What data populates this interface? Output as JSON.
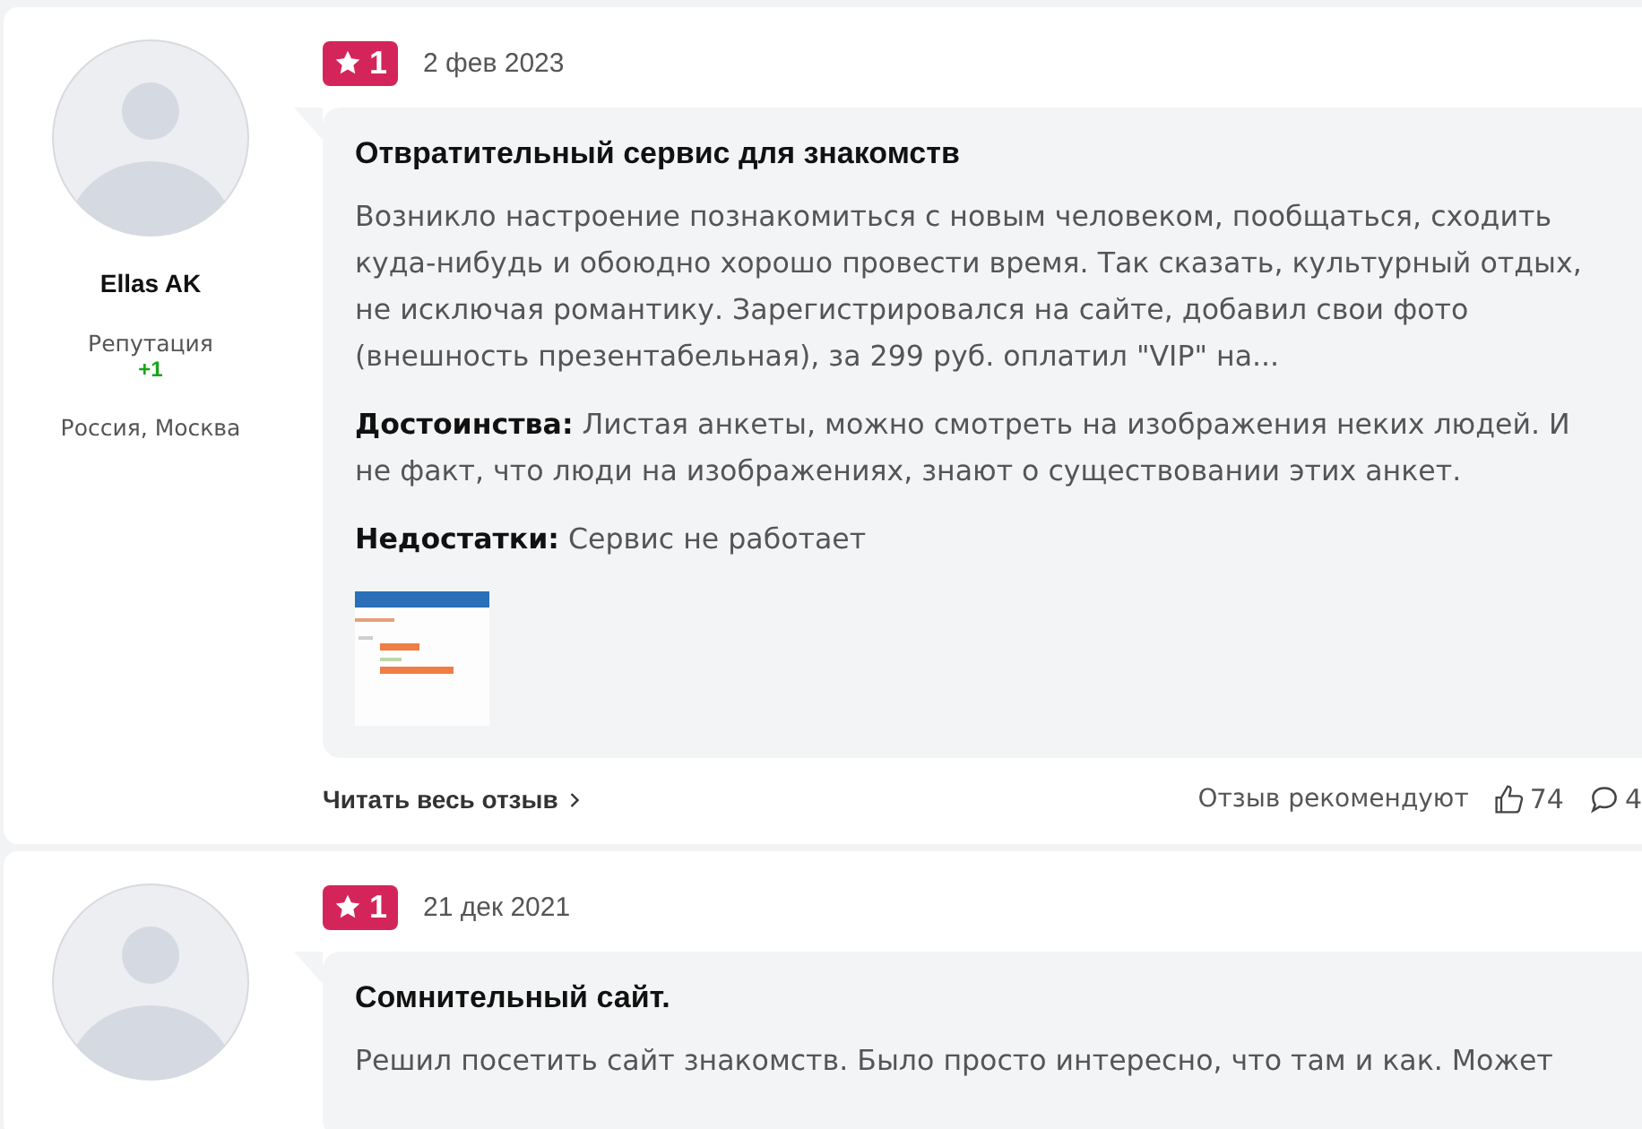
{
  "reviews": [
    {
      "author": {
        "name": "Ellas AK",
        "reputation_label": "Репутация",
        "reputation": "+1",
        "location": "Россия, Москва"
      },
      "rating": "1",
      "date": "2 фев 2023",
      "title": "Отвратительный сервис для знакомств",
      "body": "Возникло настроение познакомиться с новым человеком, пообщаться, сходить куда-нибудь и обоюдно хорошо провести время. Так сказать, культурный отдых, не исключая романтику. Зарегистрировался на сайте, добавил свои фото (внешность презентабельная), за 299 руб. оплатил \"VIP\" на...",
      "pros": "**Достоинства:** Листая анкеты, можно смотреть на изображения неких людей. И не факт, что люди на изображениях, знают о существовании этих анкет.",
      "cons": "**Недостатки:** Сервис не работает",
      "read_more": "Читать весь отзыв",
      "recommend_label": "Отзыв рекомендуют",
      "likes": "74",
      "comments": "4"
    },
    {
      "rating": "1",
      "date": "21 дек 2021",
      "title": "Сомнительный сайт.",
      "body": "Решил посетить сайт знакомств. Было просто интересно, что там и как. Может"
    }
  ]
}
